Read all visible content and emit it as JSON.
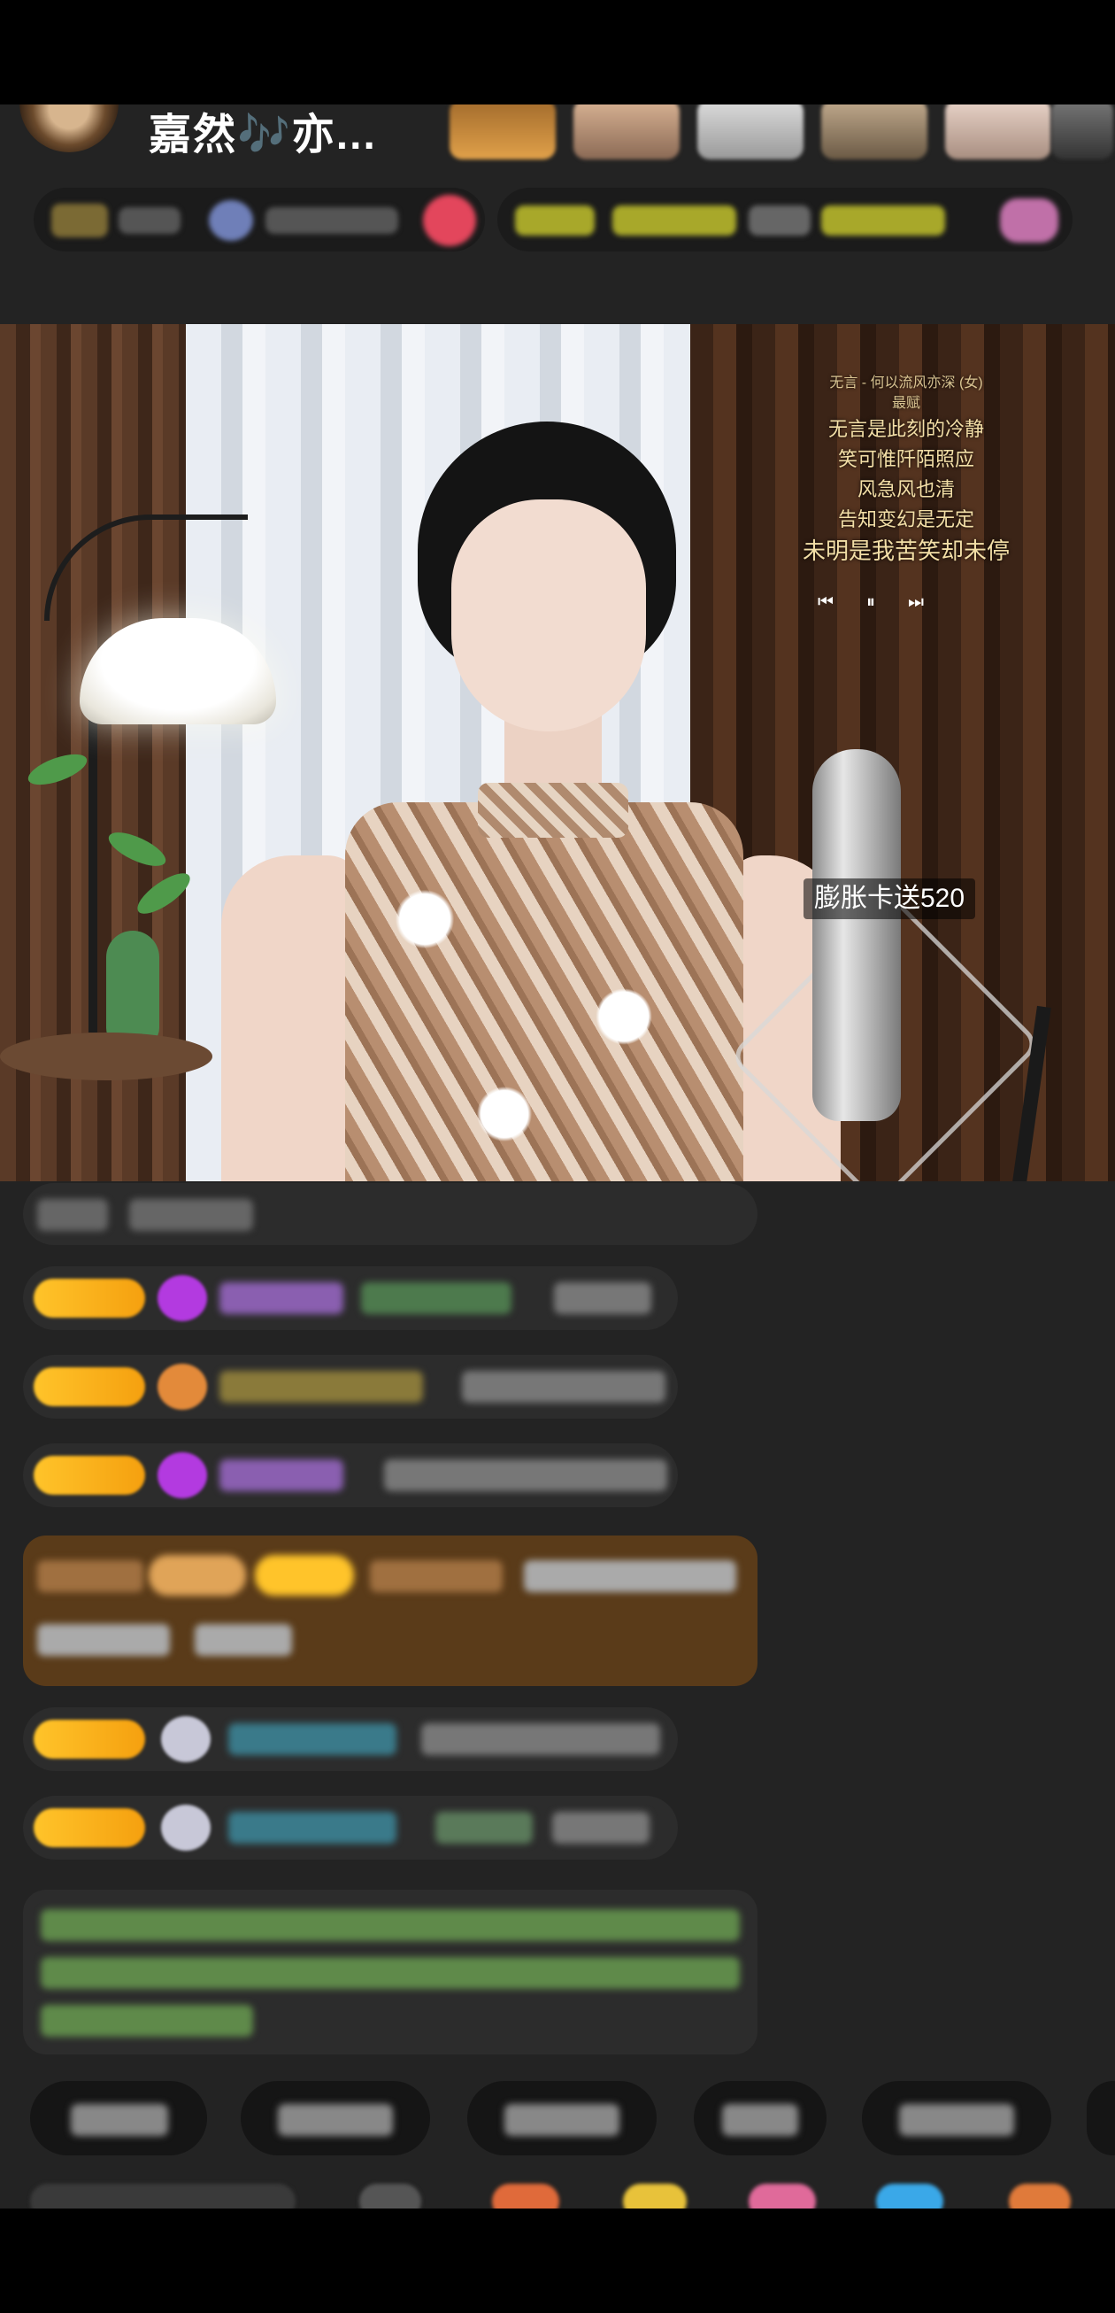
{
  "header": {
    "host_name": "嘉然🎶亦..."
  },
  "video": {
    "lyrics": {
      "song_title": "无言 - 何以流风亦深 (女)",
      "subtitle": "最赋",
      "lines": [
        "无言是此刻的冷静",
        "笑可惟阡陌照应",
        "风急风也清",
        "告知变幻是无定"
      ],
      "last_line": "未明是我苦笑却未停"
    },
    "player": {
      "prev_icon": "⏮",
      "pause_icon": "⏸",
      "next_icon": "⏭"
    },
    "gift_tag": "膨胀卡送520"
  },
  "colors": {
    "background": "#232323",
    "level_badge": "#ffc42a",
    "lyric_text": "#f3dfa7",
    "chat_bubble": "#2c2c2c"
  }
}
